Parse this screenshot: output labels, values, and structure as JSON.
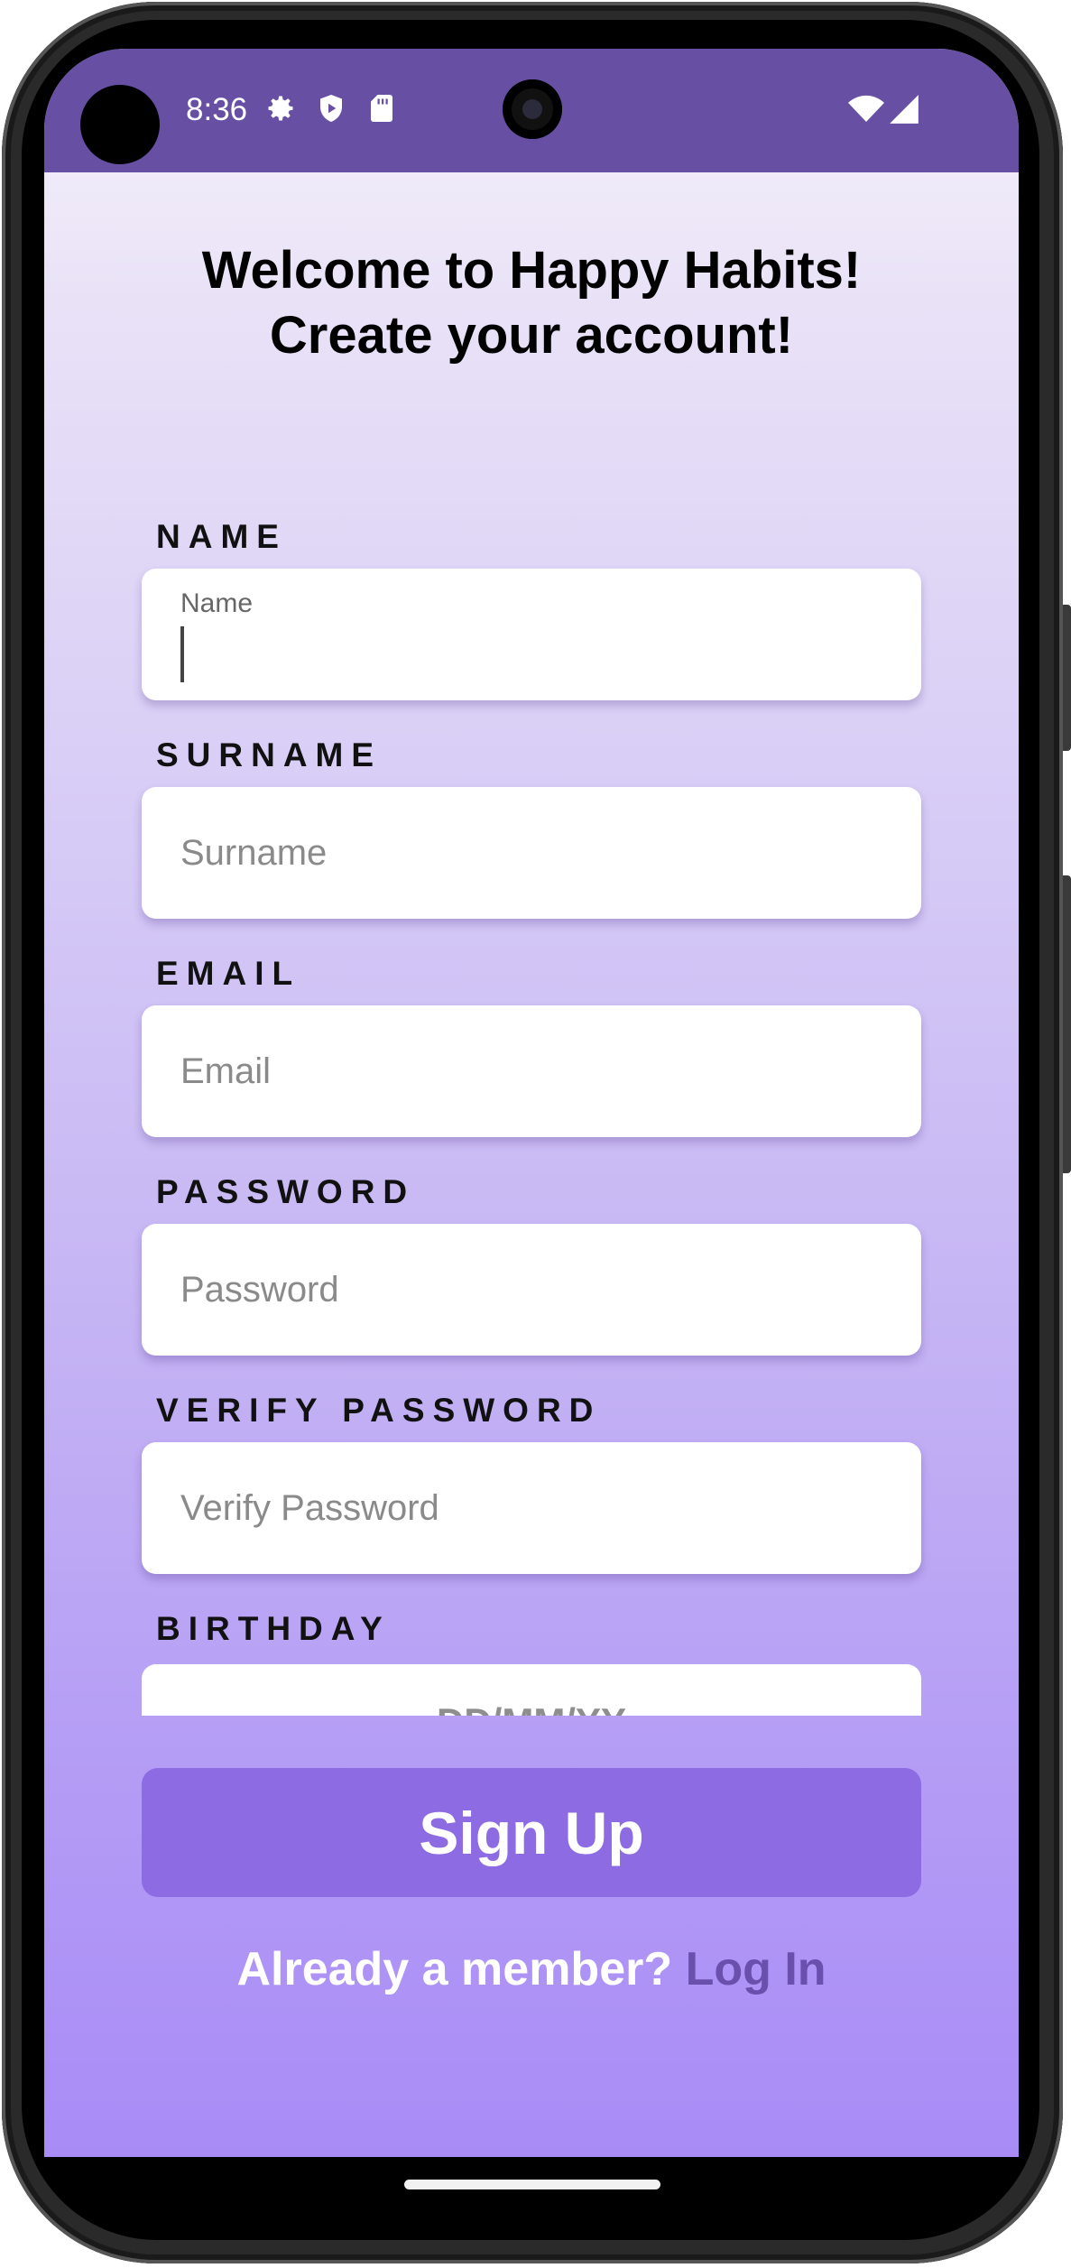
{
  "status_bar": {
    "time": "8:36",
    "background_color": "#6750a4",
    "left_icons": [
      "gear-icon",
      "shield-play-icon",
      "sd-card-icon"
    ],
    "right_icons": [
      "wifi-icon",
      "cell-signal-icon"
    ]
  },
  "header": {
    "title_line1": "Welcome to Happy Habits!",
    "title_line2": "Create your account!"
  },
  "form": {
    "name": {
      "label": "NAME",
      "floating_label": "Name",
      "value": ""
    },
    "surname": {
      "label": "SURNAME",
      "placeholder": "Surname",
      "value": ""
    },
    "email": {
      "label": "EMAIL",
      "placeholder": "Email",
      "value": ""
    },
    "password": {
      "label": "PASSWORD",
      "placeholder": "Password",
      "value": ""
    },
    "verify_password": {
      "label": "VERIFY PASSWORD",
      "placeholder": "Verify Password",
      "value": ""
    },
    "birthday": {
      "label": "BIRTHDAY",
      "placeholder": "DD/MM/YY"
    }
  },
  "actions": {
    "signup_label": "Sign Up",
    "signup_color": "#8d6be3",
    "login_prompt": "Already a member?",
    "login_link": "Log In",
    "login_link_color": "#6b4fad"
  }
}
